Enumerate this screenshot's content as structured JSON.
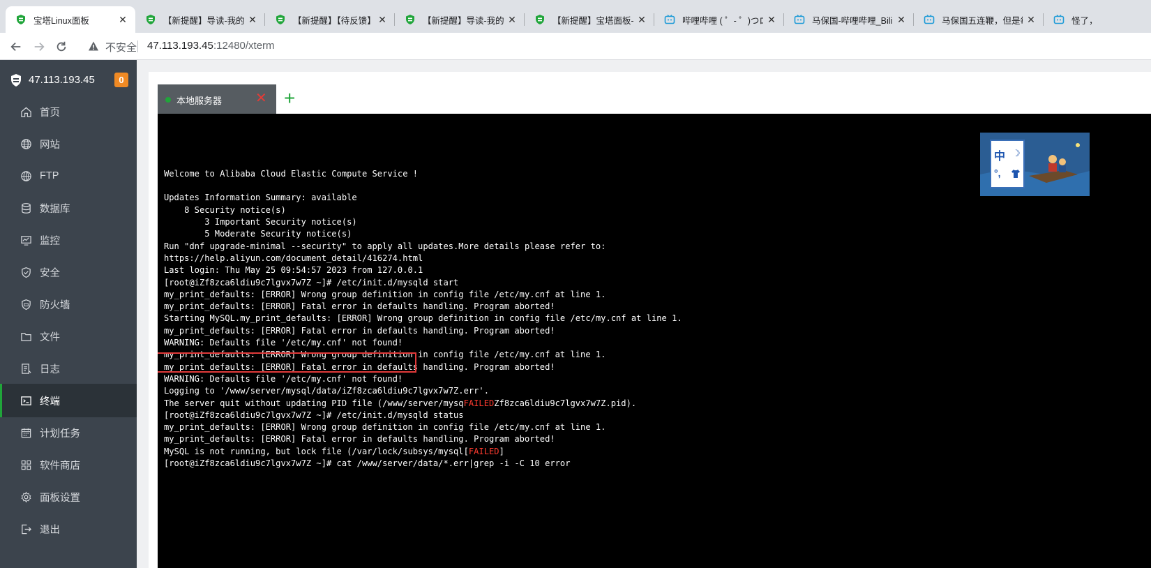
{
  "browser": {
    "tabs": [
      {
        "title": "宝塔Linux面板",
        "icon": "bt-shield-icon",
        "active": true
      },
      {
        "title": "【新提醒】导读-我的",
        "icon": "bt-shield-icon"
      },
      {
        "title": "【新提醒】【待反馈】",
        "icon": "bt-shield-icon"
      },
      {
        "title": "【新提醒】导读-我的",
        "icon": "bt-shield-icon"
      },
      {
        "title": "【新提醒】宝塔面板-",
        "icon": "bt-shield-icon"
      },
      {
        "title": "哔哩哔哩 ( ゜- ゜)つロ",
        "icon": "bilibili-tv-icon"
      },
      {
        "title": "马保国-哔哩哔哩_Bilib",
        "icon": "bilibili-tv-icon"
      },
      {
        "title": "马保国五连鞭，但是每",
        "icon": "bilibili-tv-icon"
      },
      {
        "title": "怪了，",
        "icon": "bilibili-tv-icon"
      }
    ],
    "security_label": "不安全",
    "url_host": "47.113.193.45",
    "url_path": ":12480/xterm"
  },
  "sidebar": {
    "server_ip": "47.113.193.45",
    "badge_count": "0",
    "items": [
      {
        "label": "首页",
        "icon": "home-icon"
      },
      {
        "label": "网站",
        "icon": "globe-icon"
      },
      {
        "label": "FTP",
        "icon": "ftp-globe-icon"
      },
      {
        "label": "数据库",
        "icon": "database-icon"
      },
      {
        "label": "监控",
        "icon": "monitor-icon"
      },
      {
        "label": "安全",
        "icon": "shield-icon"
      },
      {
        "label": "防火墙",
        "icon": "firewall-icon"
      },
      {
        "label": "文件",
        "icon": "folder-icon"
      },
      {
        "label": "日志",
        "icon": "log-icon"
      },
      {
        "label": "终端",
        "icon": "terminal-icon",
        "active": true
      },
      {
        "label": "计划任务",
        "icon": "calendar-icon"
      },
      {
        "label": "软件商店",
        "icon": "apps-grid-icon"
      },
      {
        "label": "面板设置",
        "icon": "gear-icon"
      },
      {
        "label": "退出",
        "icon": "logout-icon"
      }
    ]
  },
  "terminal": {
    "tab_label": "本地服务器",
    "add_label": "+",
    "close_label": "✕",
    "lines": [
      [
        {
          "text": "Welcome to Alibaba Cloud Elastic Compute Service !"
        }
      ],
      [
        {
          "text": ""
        }
      ],
      [
        {
          "text": "Updates Information Summary: available"
        }
      ],
      [
        {
          "text": "    8 Security notice(s)"
        }
      ],
      [
        {
          "text": "        3 Important Security notice(s)"
        }
      ],
      [
        {
          "text": "        5 Moderate Security notice(s)"
        }
      ],
      [
        {
          "text": "Run \"dnf upgrade-minimal --security\" to apply all updates.More details please refer to:"
        }
      ],
      [
        {
          "text": "https://help.aliyun.com/document_detail/416274.html"
        }
      ],
      [
        {
          "text": "Last login: Thu May 25 09:54:57 2023 from 127.0.0.1"
        }
      ],
      [
        {
          "text": "[root@iZf8zca6ldiu9c7lgvx7w7Z ~]# /etc/init.d/mysqld start"
        }
      ],
      [
        {
          "text": "my_print_defaults: [ERROR] Wrong group definition in config file /etc/my.cnf at line 1."
        }
      ],
      [
        {
          "text": "my_print_defaults: [ERROR] Fatal error in defaults handling. Program aborted!"
        }
      ],
      [
        {
          "text": "Starting MySQL.my_print_defaults: [ERROR] Wrong group definition in config file /etc/my.cnf at line 1."
        }
      ],
      [
        {
          "text": "my_print_defaults: [ERROR] Fatal error in defaults handling. Program aborted!"
        }
      ],
      [
        {
          "text": "WARNING: Defaults file '/etc/my.cnf' not found!"
        }
      ],
      [
        {
          "text": "my_print_defaults: [ERROR] Wrong group definition in config file /etc/my.cnf at line 1."
        }
      ],
      [
        {
          "text": "my_print_defaults: [ERROR] Fatal error in defaults handling. Program aborted!"
        }
      ],
      [
        {
          "text": "WARNING: Defaults file '/etc/my.cnf' not found!"
        }
      ],
      [
        {
          "text": "Logging to '/www/server/mysql/data/iZf8zca6ldiu9c7lgvx7w7Z.err'."
        }
      ],
      [
        {
          "text": "The server quit without updating PID file (/www/server/mysq"
        },
        {
          "text": "FAILED",
          "status": "failed"
        },
        {
          "text": "Zf8zca6ldiu9c7lgvx7w7Z.pid)."
        }
      ],
      [
        {
          "text": "[root@iZf8zca6ldiu9c7lgvx7w7Z ~]# /etc/init.d/mysqld status"
        }
      ],
      [
        {
          "text": "my_print_defaults: [ERROR] Wrong group definition in config file /etc/my.cnf at line 1."
        }
      ],
      [
        {
          "text": "my_print_defaults: [ERROR] Fatal error in defaults handling. Program aborted!"
        }
      ],
      [
        {
          "text": "MySQL is not running, but lock file (/var/lock/subsys/mysql["
        },
        {
          "text": "FAILED",
          "status": "failed"
        },
        {
          "text": "]"
        }
      ],
      [
        {
          "text": "[root@iZf8zca6ldiu9c7lgvx7w7Z ~]# cat /www/server/data/*.err|grep -i -C 10 error"
        }
      ]
    ]
  },
  "ime": {
    "lang_label": "中",
    "moon_label": "☽",
    "punct_label": "°,"
  },
  "colors": {
    "sidebar_bg": "#3c444d",
    "sidebar_active": "#20a53a",
    "failed": "#ff3b2f",
    "highlight": "#e23a3a",
    "terminal_bg": "#000000"
  }
}
